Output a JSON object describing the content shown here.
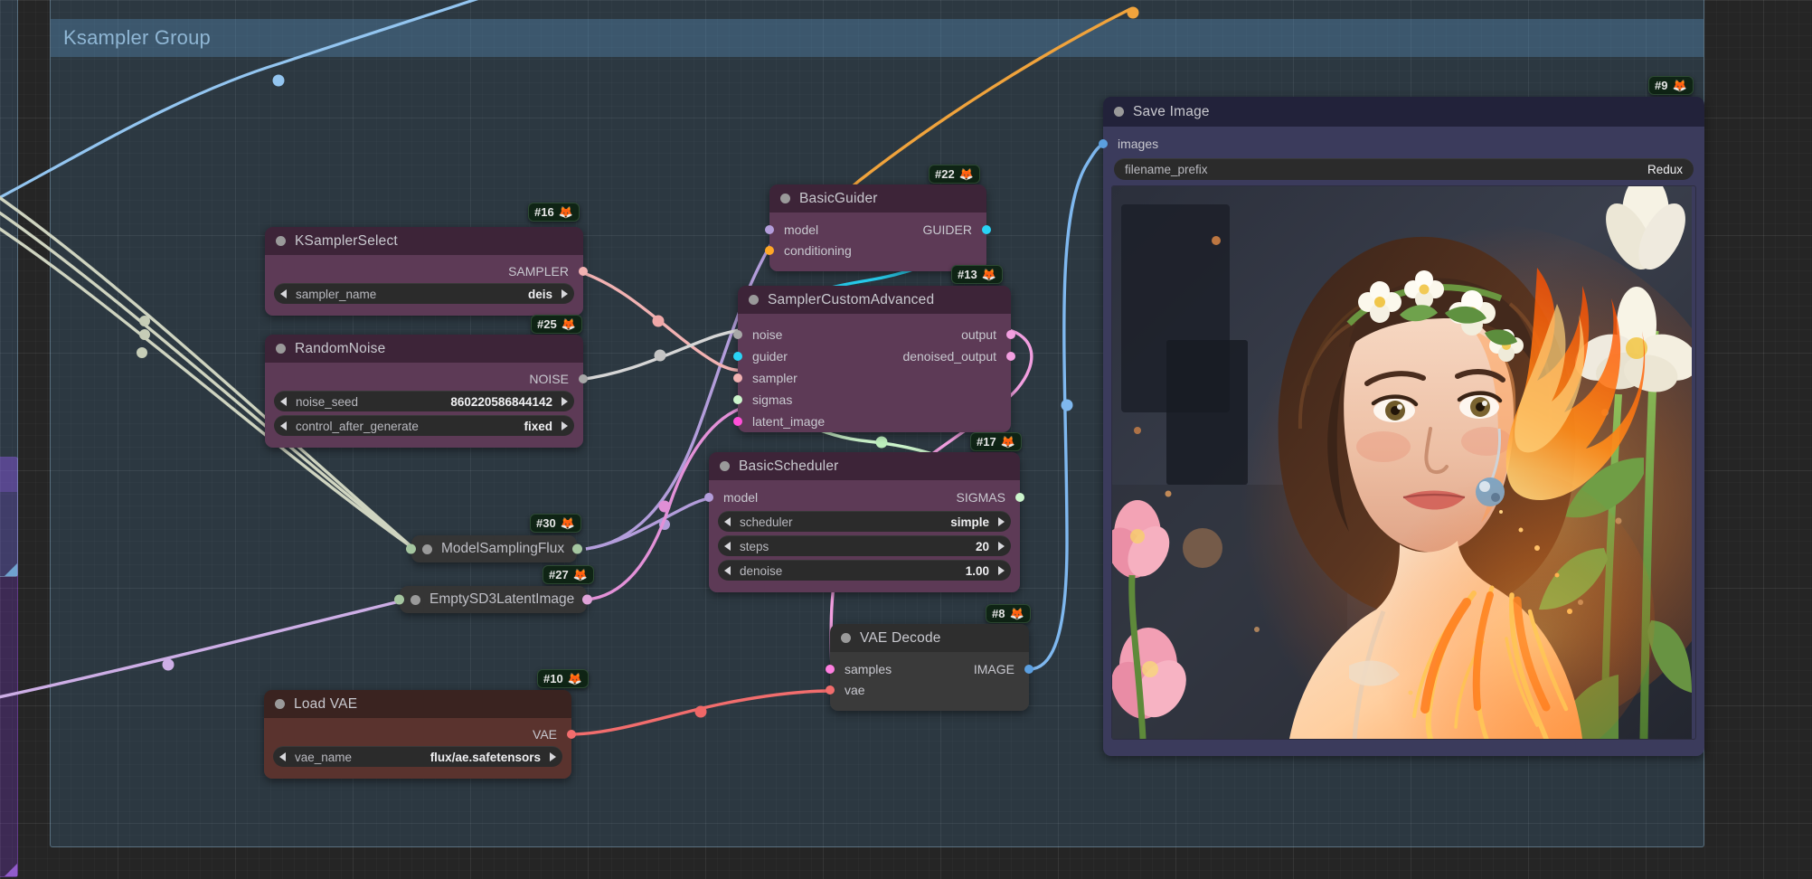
{
  "app": {
    "canvas_label": "ComfyUI node graph canvas"
  },
  "groups": [
    {
      "title": "Ksampler Group",
      "color": "#4a7fa8",
      "title_color": "#8fb6d4"
    },
    {
      "title": "",
      "color": "#7b3fc4",
      "title_color": "#a77ae0"
    }
  ],
  "nodes": [
    {
      "id": "ksampler-select",
      "badge": "#16",
      "title": "KSamplerSelect",
      "header_color": "#3d2438",
      "body_color": "#5d3a56",
      "outputs": [
        {
          "label": "SAMPLER",
          "color": "#f2b2b2"
        }
      ],
      "inputs": [],
      "widgets": [
        {
          "name": "sampler_name",
          "value": "deis"
        }
      ]
    },
    {
      "id": "random-noise",
      "badge": "#25",
      "title": "RandomNoise",
      "header_color": "#3d2438",
      "body_color": "#5d3a56",
      "outputs": [
        {
          "label": "NOISE",
          "color": "#a8a8a8"
        }
      ],
      "inputs": [],
      "widgets": [
        {
          "name": "noise_seed",
          "value": "860220586844142"
        },
        {
          "name": "control_after_generate",
          "value": "fixed"
        }
      ]
    },
    {
      "id": "basic-guider",
      "badge": "#22",
      "title": "BasicGuider",
      "header_color": "#3d2438",
      "body_color": "#5d3a56",
      "inputs": [
        {
          "label": "model",
          "color": "#b39ddb"
        },
        {
          "label": "conditioning",
          "color": "#ffa726"
        }
      ],
      "outputs": [
        {
          "label": "GUIDER",
          "color": "#29d3f5"
        }
      ],
      "widgets": []
    },
    {
      "id": "sampler-custom-advanced",
      "badge": "#13",
      "title": "SamplerCustomAdvanced",
      "header_color": "#3d2438",
      "body_color": "#5d3a56",
      "inputs": [
        {
          "label": "noise",
          "color": "#a8a8a8"
        },
        {
          "label": "guider",
          "color": "#29d3f5"
        },
        {
          "label": "sampler",
          "color": "#f2b2b2"
        },
        {
          "label": "sigmas",
          "color": "#ccf5cc"
        },
        {
          "label": "latent_image",
          "color": "#ff4fd8"
        }
      ],
      "outputs": [
        {
          "label": "output",
          "color": "#f29fe0"
        },
        {
          "label": "denoised_output",
          "color": "#f29fe0"
        }
      ],
      "widgets": []
    },
    {
      "id": "basic-scheduler",
      "badge": "#17",
      "title": "BasicScheduler",
      "header_color": "#3d2438",
      "body_color": "#5d3a56",
      "inputs": [
        {
          "label": "model",
          "color": "#b39ddb"
        }
      ],
      "outputs": [
        {
          "label": "SIGMAS",
          "color": "#ccf5cc"
        }
      ],
      "widgets": [
        {
          "name": "scheduler",
          "value": "simple"
        },
        {
          "name": "steps",
          "value": "20"
        },
        {
          "name": "denoise",
          "value": "1.00"
        }
      ]
    },
    {
      "id": "vae-decode",
      "badge": "#8",
      "title": "VAE Decode",
      "header_color": "#2e2e2e",
      "body_color": "#3a3a3a",
      "inputs": [
        {
          "label": "samples",
          "color": "#ff7fe0"
        },
        {
          "label": "vae",
          "color": "#f26d6d"
        }
      ],
      "outputs": [
        {
          "label": "IMAGE",
          "color": "#5b9fe0"
        }
      ],
      "widgets": []
    },
    {
      "id": "load-vae",
      "badge": "#10",
      "title": "Load VAE",
      "header_color": "#3a2320",
      "body_color": "#5a332e",
      "inputs": [],
      "outputs": [
        {
          "label": "VAE",
          "color": "#f26d6d"
        }
      ],
      "widgets": [
        {
          "name": "vae_name",
          "value": "flux/ae.safetensors"
        }
      ]
    },
    {
      "id": "save-image",
      "badge": "#9",
      "title": "Save Image",
      "header_color": "#22223a",
      "body_color": "#3b3b5c",
      "inputs": [
        {
          "label": "images",
          "color": "#5b9fe0"
        }
      ],
      "outputs": [],
      "widgets": [
        {
          "name": "filename_prefix",
          "value": "Redux"
        }
      ]
    }
  ],
  "collapsed_nodes": [
    {
      "badge": "#30",
      "title": "ModelSamplingFlux"
    },
    {
      "badge": "#27",
      "title": "EmptySD3LatentImage"
    }
  ],
  "icons": {
    "node_status": "circle-icon",
    "badge_emoji": "fox-icon",
    "arrow_left": "caret-left-icon",
    "arrow_right": "caret-right-icon"
  },
  "preview": {
    "alt": "Generated portrait of a woman with flower crown surrounded by orange flames and white lotus flowers"
  }
}
